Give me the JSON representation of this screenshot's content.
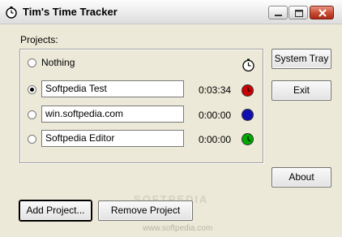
{
  "window": {
    "title": "Tim's Time Tracker",
    "minimize_icon": "minimize-icon",
    "maximize_icon": "maximize-icon",
    "close_icon": "close-icon",
    "app_icon": "stopwatch-icon"
  },
  "projects_label": "Projects:",
  "rows": [
    {
      "label": "Nothing",
      "checked": false,
      "icon": "clock-icon"
    },
    {
      "value": "Softpedia Test",
      "time": "0:03:34",
      "color": "#cc0000",
      "checked": true
    },
    {
      "value": "win.softpedia.com",
      "time": "0:00:00",
      "color": "#1010b0",
      "checked": false
    },
    {
      "value": "Softpedia Editor",
      "time": "0:00:00",
      "color": "#00aa00",
      "checked": false
    }
  ],
  "buttons": {
    "system_tray": "System Tray",
    "exit": "Exit",
    "about": "About",
    "add_project": "Add Project...",
    "remove_project": "Remove Project"
  },
  "watermark": {
    "line1": "SOFTPEDIA",
    "line2": "www.softpedia.com"
  }
}
